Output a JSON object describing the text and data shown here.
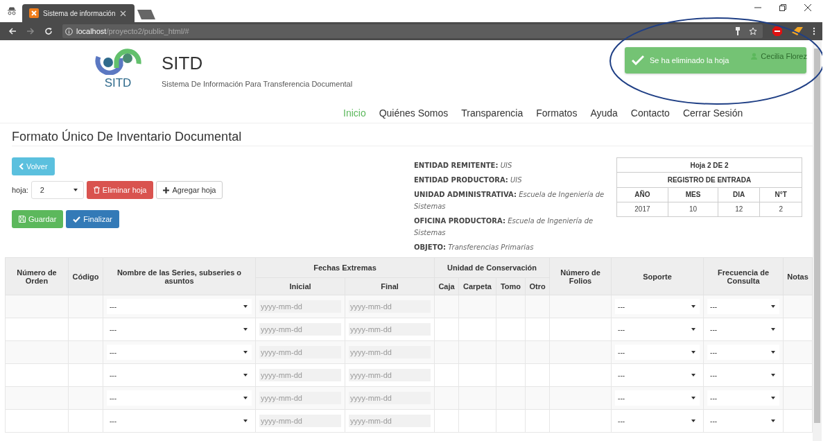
{
  "browser": {
    "tab_title": "Sistema de información",
    "url_host": "localhost",
    "url_path": "/proyecto2/public_html/#"
  },
  "header": {
    "logo_text": "SITD",
    "title": "SITD",
    "subtitle": "Sistema De Información Para Transferencia Documental"
  },
  "nav": [
    {
      "label": "Inicio",
      "selected": true
    },
    {
      "label": "Quiénes Somos",
      "selected": false
    },
    {
      "label": "Transparencia",
      "selected": false
    },
    {
      "label": "Formatos",
      "selected": false
    },
    {
      "label": "Ayuda",
      "selected": false
    },
    {
      "label": "Contacto",
      "selected": false
    },
    {
      "label": "Cerrar Sesión",
      "selected": false
    }
  ],
  "user": "Cecilia Florez",
  "toast": {
    "message": "Se ha eliminado la hoja"
  },
  "page_title": "Formato Único De Inventario Documental",
  "controls": {
    "back": "Volver",
    "sheet_label": "hoja:",
    "sheet_value": "2",
    "delete": "Eliminar hoja",
    "add": "Agregar hoja",
    "save": "Guardar",
    "finish": "Finalizar"
  },
  "info": [
    {
      "label": "ENTIDAD REMITENTE:",
      "value": "UIS"
    },
    {
      "label": "ENTIDAD PRODUCTORA:",
      "value": "UIS"
    },
    {
      "label": "UNIDAD ADMINISTRATIVA:",
      "value": "Escuela de Ingeniería de Sistemas"
    },
    {
      "label": "OFICINA PRODUCTORA:",
      "value": "Escuela de Ingeniería de Sistemas"
    },
    {
      "label": "OBJETO:",
      "value": "Transferencias Primarias"
    }
  ],
  "registro": {
    "sheet": "Hoja 2 DE 2",
    "title": "REGISTRO DE ENTRADA",
    "columns": [
      "AÑO",
      "MES",
      "DIA",
      "N°T"
    ],
    "values": [
      "2017",
      "10",
      "12",
      "2"
    ]
  },
  "table": {
    "headers": {
      "orden": "Número de Orden",
      "codigo": "Código",
      "series": "Nombre de las Series, subseries o asuntos",
      "fechas": "Fechas Extremas",
      "inicial": "Inicial",
      "final": "Final",
      "unidad": "Unidad de Conservación",
      "caja": "Caja",
      "carpeta": "Carpeta",
      "tomo": "Tomo",
      "otro": "Otro",
      "folios": "Número de Folios",
      "soporte": "Soporte",
      "frecuencia": "Frecuencia de Consulta",
      "notas": "Notas"
    },
    "rows": [
      {
        "series": "---",
        "inicial": {
          "placeholder": "yyyy-mm-dd"
        },
        "final": {
          "placeholder": "yyyy-mm-dd"
        },
        "soporte": "---",
        "frecuencia": "---"
      },
      {
        "series": "---",
        "inicial": {
          "placeholder": "yyyy-mm-dd"
        },
        "final": {
          "placeholder": "yyyy-mm-dd"
        },
        "soporte": "---",
        "frecuencia": "---"
      },
      {
        "series": "---",
        "inicial": {
          "placeholder": "yyyy-mm-dd"
        },
        "final": {
          "placeholder": "yyyy-mm-dd"
        },
        "soporte": "---",
        "frecuencia": "---"
      },
      {
        "series": "---",
        "inicial": {
          "placeholder": "yyyy-mm-dd"
        },
        "final": {
          "placeholder": "yyyy-mm-dd"
        },
        "soporte": "---",
        "frecuencia": "---"
      },
      {
        "series": "---",
        "inicial": {
          "placeholder": "yyyy-mm-dd"
        },
        "final": {
          "placeholder": "yyyy-mm-dd"
        },
        "soporte": "---",
        "frecuencia": "---"
      },
      {
        "series": "---",
        "inicial": {
          "placeholder": "yyyy-mm-dd"
        },
        "final": {
          "placeholder": "yyyy-mm-dd"
        },
        "soporte": "---",
        "frecuencia": "---"
      }
    ]
  }
}
